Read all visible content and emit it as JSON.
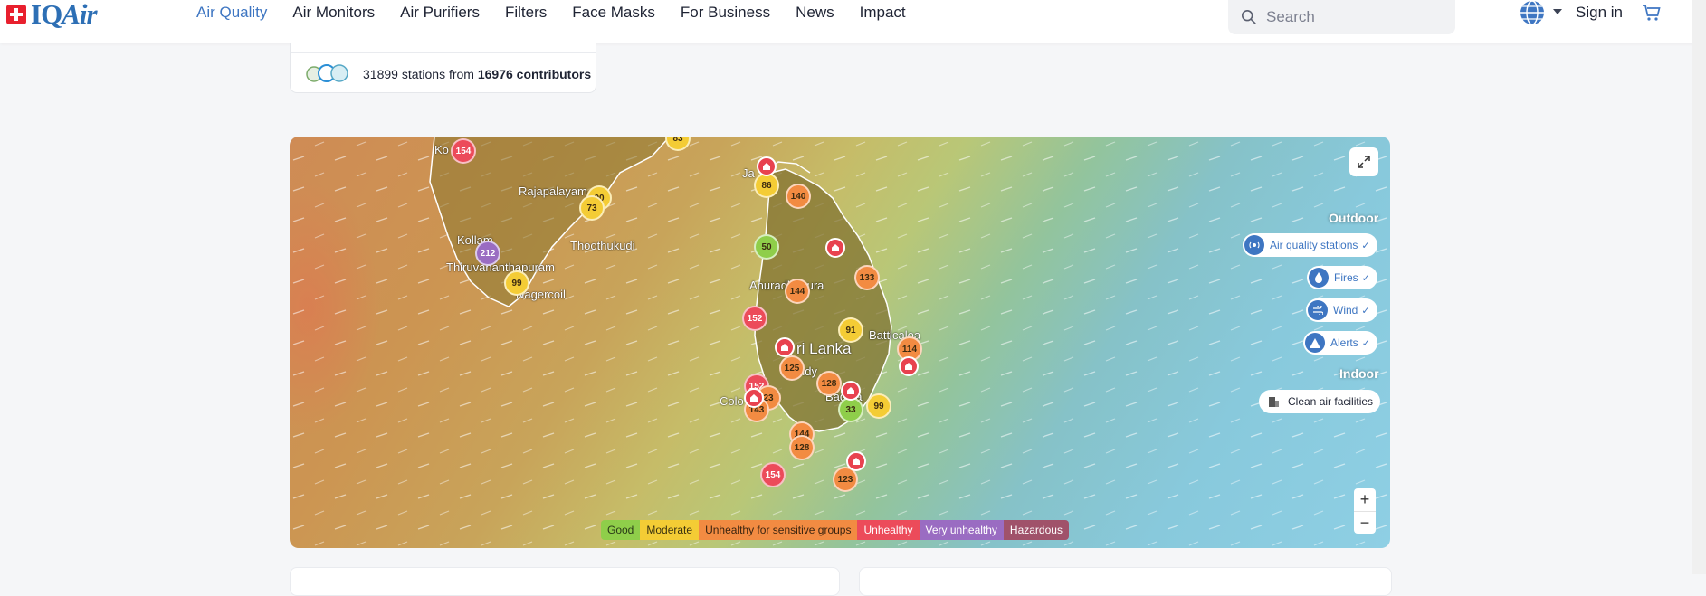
{
  "header": {
    "logo": "IQAir",
    "nav": [
      "Air Quality",
      "Air Monitors",
      "Air Purifiers",
      "Filters",
      "Face Masks",
      "For Business",
      "News",
      "Impact"
    ],
    "active_nav": "Air Quality",
    "search_placeholder": "Search",
    "signin_label": "Sign in"
  },
  "stations": {
    "count": "31899",
    "text_mid": "stations from",
    "contributors": "16976 contributors"
  },
  "map": {
    "labels": [
      "Ko",
      "Rajapalayam",
      "Kollam",
      "Thoothukudi",
      "Thiruvananthapuram",
      "Nagercoil",
      "Ja",
      "Anuradhapura",
      "Batticaloa",
      "ri Lanka",
      "ndy",
      "Badula",
      "Colo"
    ],
    "markers": [
      "154",
      "83",
      "86",
      "140",
      "90",
      "73",
      "212",
      "50",
      "133",
      "99",
      "144",
      "152",
      "91",
      "114",
      "125",
      "128",
      "152",
      "23",
      "143",
      "99",
      "33",
      "144",
      "128",
      "154",
      "123"
    ],
    "outdoor_label": "Outdoor",
    "indoor_label": "Indoor",
    "toggles": {
      "stations": "Air quality stations",
      "fires": "Fires",
      "wind": "Wind",
      "alerts": "Alerts",
      "clean": "Clean air facilities"
    },
    "zoom_in": "+",
    "zoom_out": "−"
  },
  "legend": {
    "good": "Good",
    "moderate": "Moderate",
    "usg": "Unhealthy for sensitive groups",
    "unhealthy": "Unhealthy",
    "very": "Very unhealthy",
    "hazardous": "Hazardous"
  },
  "colors": {
    "brand": "#2d6fb5",
    "good": "#8fce4a",
    "moderate": "#f4cc35",
    "usg": "#f28b42",
    "unhealthy": "#ec4b5a",
    "very_unhealthy": "#9a6cc2",
    "hazardous": "#a0526a"
  }
}
